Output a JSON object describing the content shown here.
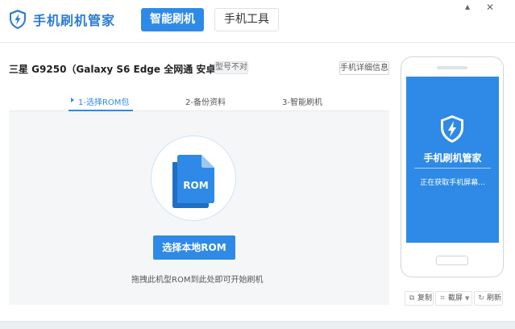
{
  "app": {
    "title": "手机刷机管家"
  },
  "tabs": {
    "flash": "智能刷机",
    "tools": "手机工具"
  },
  "window": {
    "minimize": "▲",
    "close": "✕"
  },
  "device": {
    "name": "三星  G9250（Galaxy S6 Edge 全网通 安卓6.0）",
    "mismatch_badge": "型号不对",
    "detail_button": "手机详细信息"
  },
  "steps": [
    {
      "label": "1-选择ROM包",
      "active": true
    },
    {
      "label": "2-备份资料",
      "active": false
    },
    {
      "label": "3-智能刷机",
      "active": false
    }
  ],
  "drop": {
    "rom_label": "ROM",
    "select_button": "选择本地ROM",
    "hint": "拖拽此机型ROM到此处即可开始刷机"
  },
  "phone": {
    "title": "手机刷机管家",
    "status": "正在获取手机屏幕..."
  },
  "phone_tools": {
    "copy": "复制",
    "screenshot": "截屏",
    "refresh": "刷新"
  },
  "colors": {
    "accent": "#2e8ae6",
    "title": "#2b7cd3"
  },
  "icons": {
    "logo": "shield-lightning-icon",
    "copy": "copy-icon",
    "screenshot": "crop-icon",
    "refresh": "refresh-icon"
  }
}
